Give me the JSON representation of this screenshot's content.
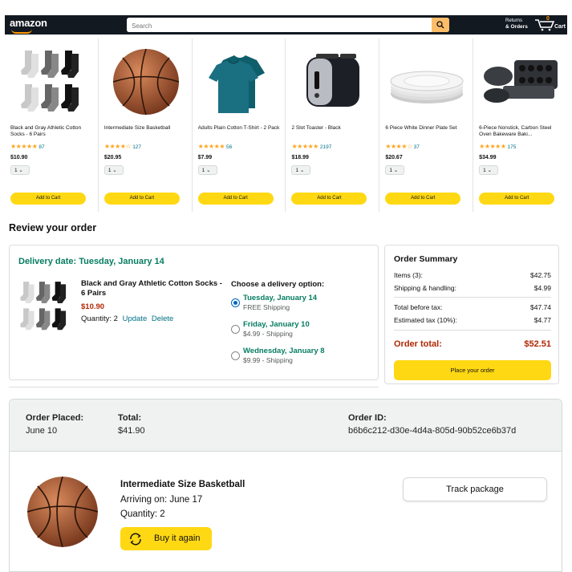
{
  "header": {
    "logo": "amazon",
    "search_placeholder": "Search",
    "returns_line1": "Returns",
    "returns_line2": "& Orders",
    "cart_count": "0",
    "cart_label": "Cart"
  },
  "products": [
    {
      "name": "Black and Gray Athletic Cotton Socks - 6 Pairs",
      "stars": "★★★★★",
      "rating_count": "87",
      "price": "$10.90",
      "qty": "1",
      "button": "Add to Cart",
      "icon": "socks"
    },
    {
      "name": "Intermediate Size Basketball",
      "stars": "★★★★☆",
      "rating_count": "127",
      "price": "$20.95",
      "qty": "1",
      "button": "Add to Cart",
      "icon": "basketball"
    },
    {
      "name": "Adults Plain Cotton T-Shirt - 2 Pack",
      "stars": "★★★★★",
      "rating_count": "56",
      "price": "$7.99",
      "qty": "1",
      "button": "Add to Cart",
      "icon": "tshirt"
    },
    {
      "name": "2 Slot Toaster - Black",
      "stars": "★★★★★",
      "rating_count": "2197",
      "price": "$18.99",
      "qty": "1",
      "button": "Add to Cart",
      "icon": "toaster"
    },
    {
      "name": "6 Piece White Dinner Plate Set",
      "stars": "★★★★☆",
      "rating_count": "37",
      "price": "$20.67",
      "qty": "1",
      "button": "Add to Cart",
      "icon": "plates"
    },
    {
      "name": "6-Piece Nonstick, Carbon Steel Oven Bakeware Baki...",
      "stars": "★★★★★",
      "rating_count": "175",
      "price": "$34.99",
      "qty": "1",
      "button": "Add to Cart",
      "icon": "bakeware"
    }
  ],
  "review": {
    "title": "Review your order",
    "delivery_date": "Delivery date: Tuesday, January 14",
    "item_name": "Black and Gray Athletic Cotton Socks - 6 Pairs",
    "item_price": "$10.90",
    "item_quantity": "Quantity: 2",
    "update": "Update",
    "delete": "Delete",
    "options_title": "Choose a delivery option:",
    "options": [
      {
        "date": "Tuesday, January 14",
        "sub": "FREE Shipping",
        "selected": true
      },
      {
        "date": "Friday, January 10",
        "sub": "$4.99 - Shipping",
        "selected": false
      },
      {
        "date": "Wednesday, January 8",
        "sub": "$9.99 - Shipping",
        "selected": false
      }
    ]
  },
  "summary": {
    "title": "Order Summary",
    "items_label": "Items (3):",
    "items_value": "$42.75",
    "shipping_label": "Shipping & handling:",
    "shipping_value": "$4.99",
    "before_tax_label": "Total before tax:",
    "before_tax_value": "$47.74",
    "tax_label": "Estimated tax (10%):",
    "tax_value": "$4.77",
    "total_label": "Order total:",
    "total_value": "$52.51",
    "place_order": "Place your order"
  },
  "order_history": {
    "placed_label": "Order Placed:",
    "placed_value": "June 10",
    "total_label": "Total:",
    "total_value": "$41.90",
    "id_label": "Order ID:",
    "id_value": "b6b6c212-d30e-4d4a-805d-90b52ce6b37d",
    "product_name": "Intermediate Size Basketball",
    "arriving": "Arriving on: June 17",
    "quantity": "Quantity: 2",
    "buy_again": "Buy it again",
    "track": "Track package"
  },
  "colors": {
    "header_bg": "#131921",
    "accent": "#ffd814",
    "green": "#067d62",
    "red": "#b12704",
    "link": "#007185"
  }
}
